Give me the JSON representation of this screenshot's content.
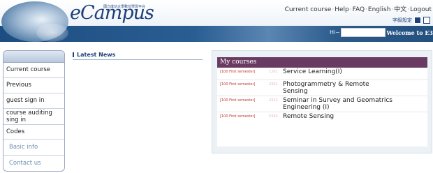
{
  "header": {
    "logo_text": "eCampus",
    "logo_subtitle": "國立成功大學數位學習平台",
    "nav": [
      "Current course",
      "Help",
      "FAQ",
      "English",
      "中文",
      "Logout"
    ],
    "settings_label": "字級設定",
    "hi_label": "Hi~",
    "welcome": "Welcome to E3"
  },
  "sidebar": {
    "items": [
      {
        "label": "Current course"
      },
      {
        "label": "Previous"
      },
      {
        "label": "guest sign in"
      },
      {
        "label": "course auditing sing in"
      },
      {
        "label": "Codes"
      },
      {
        "label": "Basic info"
      },
      {
        "label": "Contact us"
      }
    ]
  },
  "news": {
    "title": "Latest News"
  },
  "courses": {
    "title": "My courses",
    "list": [
      {
        "semester": "[100 First semester]",
        "id": "1301",
        "name": "Service Learning(I)"
      },
      {
        "semester": "[100 First semester]",
        "id": "2301",
        "name": "Photogrammetry & Remote Sensing"
      },
      {
        "semester": "[100 First semester]",
        "id": "2322",
        "name": "Seminar in Survey and Geomatrics Engineering (I)"
      },
      {
        "semester": "[100 First semester]",
        "id": "5344",
        "name": "Remote Sensing"
      }
    ]
  }
}
